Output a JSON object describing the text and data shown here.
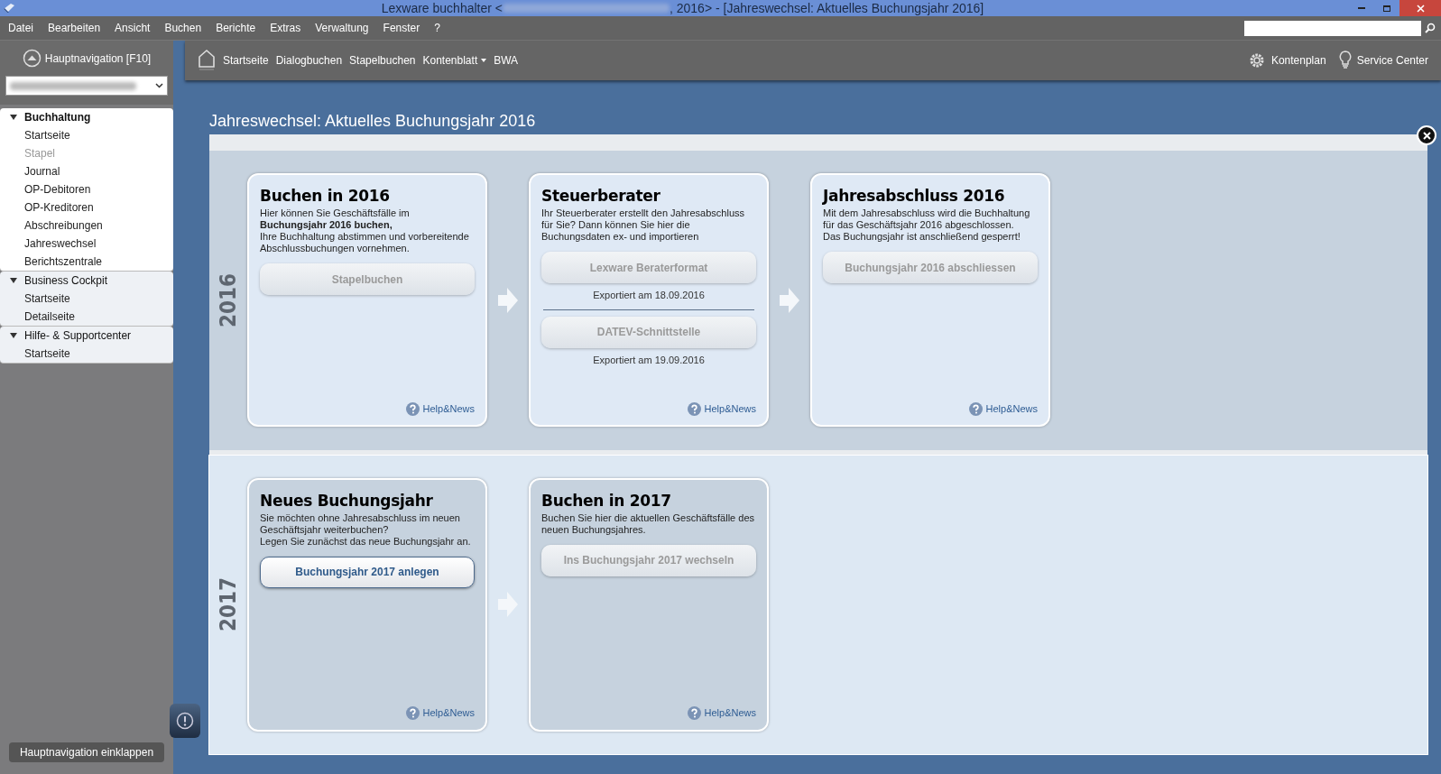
{
  "window": {
    "title_start": "Lexware buchhalter <",
    "title_end": ", 2016> - [Jahreswechsel: Aktuelles Buchungsjahr 2016]"
  },
  "menu": [
    "Datei",
    "Bearbeiten",
    "Ansicht",
    "Buchen",
    "Berichte",
    "Extras",
    "Verwaltung",
    "Fenster",
    "?"
  ],
  "toolbar": {
    "items": [
      {
        "label": "Startseite",
        "kind": "link"
      },
      {
        "label": "Dialogbuchen",
        "kind": "link"
      },
      {
        "label": "Stapelbuchen",
        "kind": "link"
      },
      {
        "label": "Kontenblatt",
        "kind": "dropdown"
      },
      {
        "label": "BWA",
        "kind": "link"
      }
    ],
    "right": [
      {
        "label": "Kontenplan",
        "kind": "gear"
      },
      {
        "label": "Service Center",
        "kind": "bulb"
      }
    ]
  },
  "sidebar": {
    "header": "Hauptnavigation [F10]",
    "collapse_button": "Hauptnavigation einklappen",
    "groups": [
      {
        "label": "Buchhaltung",
        "active": true,
        "expanded": true,
        "children": [
          {
            "label": "Startseite",
            "disabled": false
          },
          {
            "label": "Stapel",
            "disabled": true
          },
          {
            "label": "Journal",
            "disabled": false
          },
          {
            "label": "OP-Debitoren",
            "disabled": false
          },
          {
            "label": "OP-Kreditoren",
            "disabled": false
          },
          {
            "label": "Abschreibungen",
            "disabled": false
          },
          {
            "label": "Jahreswechsel",
            "disabled": false
          },
          {
            "label": "Berichtszentrale",
            "disabled": false
          }
        ]
      },
      {
        "label": "Business Cockpit",
        "active": false,
        "expanded": true,
        "children": [
          {
            "label": "Startseite",
            "disabled": false
          },
          {
            "label": "Detailseite",
            "disabled": false
          }
        ]
      },
      {
        "label": "Hilfe- & Supportcenter",
        "active": false,
        "expanded": true,
        "children": [
          {
            "label": "Startseite",
            "disabled": false
          }
        ]
      }
    ]
  },
  "page": {
    "title": "Jahreswechsel: Aktuelles Buchungsjahr 2016",
    "sections": [
      {
        "year": "2016",
        "current": true,
        "cards": [
          {
            "title": "Buchen in 2016",
            "text": "Hier können Sie Geschäftsfälle im\n**Buchungsjahr 2016 buchen,**\nIhre Buchhaltung abstimmen und vorbereitende Abschlussbuchungen vornehmen.",
            "actions": [
              {
                "label": "Stapelbuchen",
                "disabled": true
              }
            ],
            "help": "Help&News"
          },
          {
            "title": "Steuerberater",
            "text": "Ihr Steuerberater erstellt den Jahresabschluss für Sie? Dann können Sie hier die Buchungsdaten ex- und importieren",
            "actions": [
              {
                "label": "Lexware Beraterformat",
                "disabled": true,
                "note": "Exportiert am 18.09.2016"
              },
              {
                "label": "DATEV-Schnittstelle",
                "disabled": true,
                "note": "Exportiert am 19.09.2016"
              }
            ],
            "help": "Help&News"
          },
          {
            "title": "Jahresabschluss 2016",
            "text": "Mit dem Jahresabschluss wird die Buchhaltung für das Geschäftsjahr 2016 abgeschlossen.\nDas Buchungsjahr ist anschließend gesperrt!",
            "actions": [
              {
                "label": "Buchungsjahr 2016 abschliessen",
                "disabled": true
              }
            ],
            "help": "Help&News"
          }
        ]
      },
      {
        "year": "2017",
        "current": false,
        "cards": [
          {
            "title": "Neues Buchungsjahr",
            "text": "Sie möchten ohne Jahresabschluss im neuen Geschäftsjahr weiterbuchen?\nLegen Sie zunächst das neue Buchungsjahr an.",
            "actions": [
              {
                "label": "Buchungsjahr 2017 anlegen",
                "disabled": false
              }
            ],
            "help": "Help&News"
          },
          {
            "title": "Buchen in 2017",
            "text": "Buchen Sie hier die aktuellen Geschäftsfälle des neuen Buchungsjahres.",
            "actions": [
              {
                "label": "Ins Buchungsjahr 2017 wechseln",
                "disabled": true
              }
            ],
            "help": "Help&News"
          }
        ]
      }
    ]
  }
}
